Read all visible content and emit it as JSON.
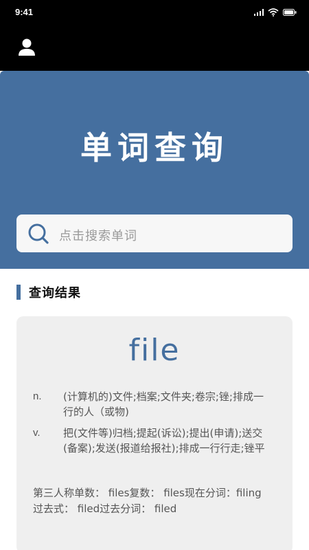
{
  "status_bar": {
    "time": "9:41",
    "icons": [
      "signal-icon",
      "wifi-icon",
      "battery-icon"
    ]
  },
  "top_bar": {
    "profile_icon": "user-icon"
  },
  "hero": {
    "title": "单词查询",
    "background_color": "#456f9f"
  },
  "search": {
    "placeholder": "点击搜索单词",
    "icon": "search-icon"
  },
  "results": {
    "section_title": "查询结果",
    "word": "file",
    "definitions": [
      {
        "pos": "n.",
        "meaning": "(计算机的)文件;档案;文件夹;卷宗;锉;排成一行的人（或物)"
      },
      {
        "pos": "v.",
        "meaning": "把(文件等)归档;提起(诉讼);提出(申请);送交(备案);发送(报道给报社);排成一行行走;锉平"
      }
    ],
    "word_forms": "第三人称单数： files复数： files现在分词：filing过去式： filed过去分词： filed"
  }
}
